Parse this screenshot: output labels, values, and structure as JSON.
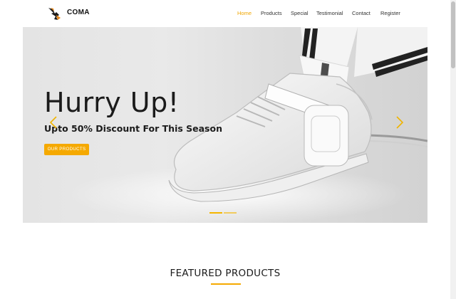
{
  "brand": {
    "name": "COMA",
    "logo": "eagle-logo-icon"
  },
  "nav": {
    "items": [
      {
        "label": "Home",
        "active": true
      },
      {
        "label": "Products",
        "active": false
      },
      {
        "label": "Special",
        "active": false
      },
      {
        "label": "Testimonial",
        "active": false
      },
      {
        "label": "Contact",
        "active": false
      },
      {
        "label": "Register",
        "active": false
      }
    ]
  },
  "hero": {
    "title": "Hurry Up!",
    "subtitle": "Upto 50% Discount For This Season",
    "cta_label": "OUR PRODUCTS",
    "prev_icon": "chevron-left-icon",
    "next_icon": "chevron-right-icon",
    "slides": 2,
    "active_slide": 1
  },
  "featured": {
    "title": "FEATURED PRODUCTS"
  },
  "colors": {
    "accent": "#f5a900",
    "active_nav": "#f0a500",
    "text": "#1b1b1b"
  }
}
